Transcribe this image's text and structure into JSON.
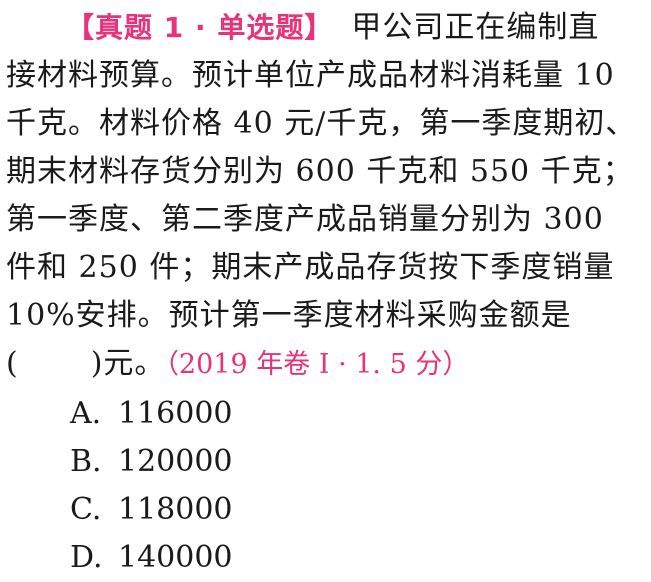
{
  "question": {
    "tag": "【真题 1 · 单选题】",
    "lines": [
      "甲公司正在编制直",
      "接材料预算。预计单位产成品材料消耗量 10",
      "千克。材料价格 40 元/千克，第一季度期初、",
      "期末材料存货分别为 600 千克和 550 千克；",
      "第一季度、第二季度产成品销量分别为 300",
      "件和 250 件；期末产成品存货按下季度销量",
      "10%安排。预计第一季度材料采购金额是"
    ],
    "blank_open": "(",
    "blank_close": ")元。",
    "source": "（2019 年卷 Ⅰ · 1. 5 分）"
  },
  "options": [
    {
      "letter": "A.",
      "value": "116000"
    },
    {
      "letter": "B.",
      "value": "120000"
    },
    {
      "letter": "C.",
      "value": "118000"
    },
    {
      "letter": "D.",
      "value": "140000"
    }
  ]
}
